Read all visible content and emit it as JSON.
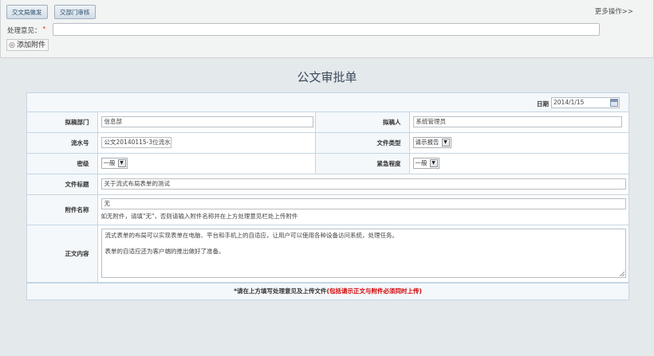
{
  "toolbar": {
    "btn_issue": "交文局做发",
    "btn_review": "交部门审核",
    "more": "更多操作>>",
    "opinion_label": "处理意见：",
    "required_mark": "*",
    "attach_label": "添加附件"
  },
  "form": {
    "title": "公文审批单",
    "date_label": "日期",
    "date_value": "2014/1/15",
    "dept_label": "拟稿部门",
    "dept_value": "信息部",
    "drafter_label": "拟稿人",
    "drafter_value": "系统管理员",
    "serial_label": "流水号",
    "serial_value": "公文20140115-3位流水",
    "doctype_label": "文件类型",
    "doctype_value": "请示报告",
    "secret_label": "密级",
    "secret_value": "一般",
    "urgency_label": "紧急程度",
    "urgency_value": "一般",
    "subject_label": "文件标题",
    "subject_value": "关于流式布局表单的测试",
    "attachname_label": "附件名称",
    "attachname_value": "无",
    "attach_hint": "如无附件，请填\"无\"，否则请输入附件名称并在上方处理意见栏处上传附件",
    "body_label": "正文内容",
    "body_line1": "流式表单的布局可以实现表单在电脑、平台和手机上的自适应，让用户可以使用各种设备访问系统，处理任务。",
    "body_line2": "表单的自适应还为客户端的推出做好了准备。",
    "footer_note": "*请在上方填写处理意见及上传文件",
    "footer_red": "(包括请示正文与附件必须同时上传)"
  },
  "colors": {
    "background": "#e4e9ec",
    "border": "#c5d6e3",
    "label_bg": "#f4f8fb",
    "required": "#d20000"
  },
  "icons": [
    "paperclip-icon",
    "calendar-icon",
    "dropdown-arrow-icon"
  ]
}
